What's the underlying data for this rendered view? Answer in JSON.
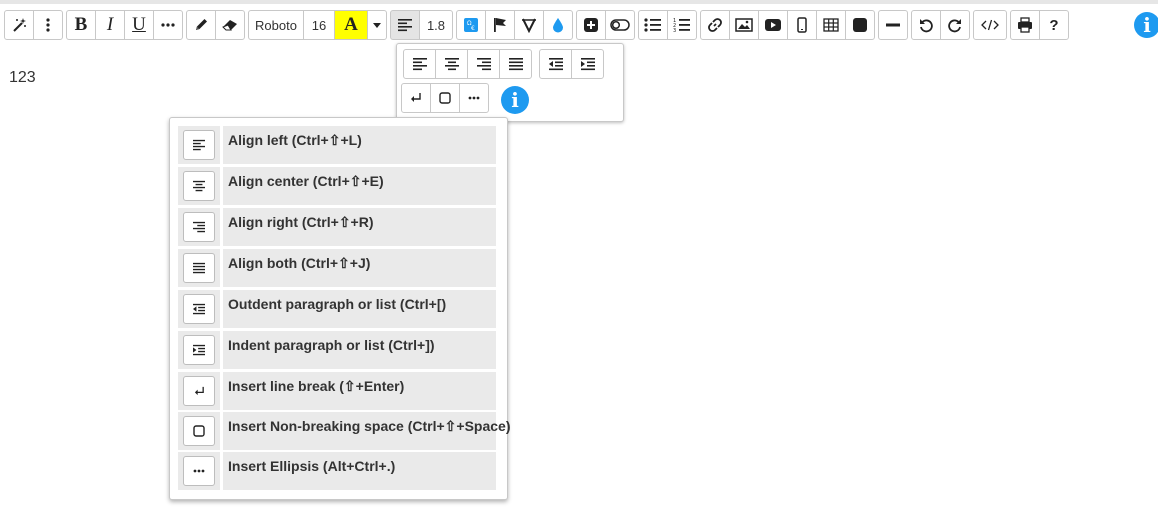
{
  "toolbar": {
    "font_family": "Roboto",
    "font_size": "16",
    "highlight_letter": "A",
    "highlight_color": "#ffff00",
    "line_height": "1.8",
    "help_label": "?",
    "info_label": "i",
    "accent_color": "#1e9af0",
    "icons": [
      "magic-wand-icon",
      "more-vertical-icon",
      "bold",
      "italic",
      "underline",
      "more-horizontal-icon",
      "pencil-icon",
      "eraser-icon",
      "font-family",
      "font-size",
      "highlight",
      "caret-down-icon",
      "align-left-icon",
      "line-height",
      "special-char-icon",
      "flag-icon",
      "strikethrough-v-icon",
      "color-drop-icon",
      "plus-box-icon",
      "toggle-icon",
      "bullet-list-icon",
      "numbered-list-icon",
      "link-icon",
      "image-icon",
      "video-icon",
      "mobile-icon",
      "table-icon",
      "black-square-icon",
      "horizontal-rule-icon",
      "undo-icon",
      "redo-icon",
      "code-icon",
      "print-icon",
      "help",
      "info-icon"
    ]
  },
  "editor": {
    "content": "123"
  },
  "align_popup": {
    "info_label": "i",
    "row1": [
      "align-left-icon",
      "align-center-icon",
      "align-right-icon",
      "align-justify-icon",
      "outdent-icon",
      "indent-icon"
    ],
    "row2": [
      "line-break-icon",
      "nbsp-icon",
      "ellipsis-icon"
    ]
  },
  "help_menu": {
    "items": [
      {
        "icon": "align-left-icon",
        "label": "Align left (Ctrl+⇧+L)"
      },
      {
        "icon": "align-center-icon",
        "label": "Align center (Ctrl+⇧+E)"
      },
      {
        "icon": "align-right-icon",
        "label": "Align right (Ctrl+⇧+R)"
      },
      {
        "icon": "align-justify-icon",
        "label": "Align both (Ctrl+⇧+J)"
      },
      {
        "icon": "outdent-icon",
        "label": "Outdent paragraph or list (Ctrl+[)"
      },
      {
        "icon": "indent-icon",
        "label": "Indent paragraph or list (Ctrl+])"
      },
      {
        "icon": "line-break-icon",
        "label": "Insert line break (⇧+Enter)"
      },
      {
        "icon": "nbsp-icon",
        "label": "Insert Non-breaking space (Ctrl+⇧+Space)"
      },
      {
        "icon": "ellipsis-icon",
        "label": "Insert Ellipsis (Alt+Ctrl+.)"
      }
    ]
  }
}
